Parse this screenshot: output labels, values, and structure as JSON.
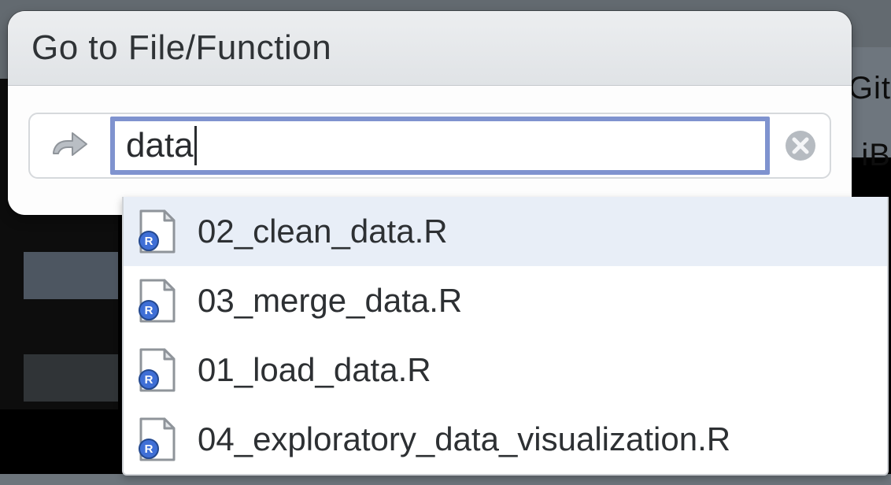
{
  "dialog": {
    "title": "Go to File/Function",
    "search_value": "data",
    "search_placeholder": ""
  },
  "results": [
    {
      "label": "02_clean_data.R",
      "selected": true
    },
    {
      "label": "03_merge_data.R",
      "selected": false
    },
    {
      "label": "01_load_data.R",
      "selected": false
    },
    {
      "label": "04_exploratory_data_visualization.R",
      "selected": false
    }
  ],
  "background": {
    "right_text_1": "Git",
    "right_text_2": "iB"
  }
}
